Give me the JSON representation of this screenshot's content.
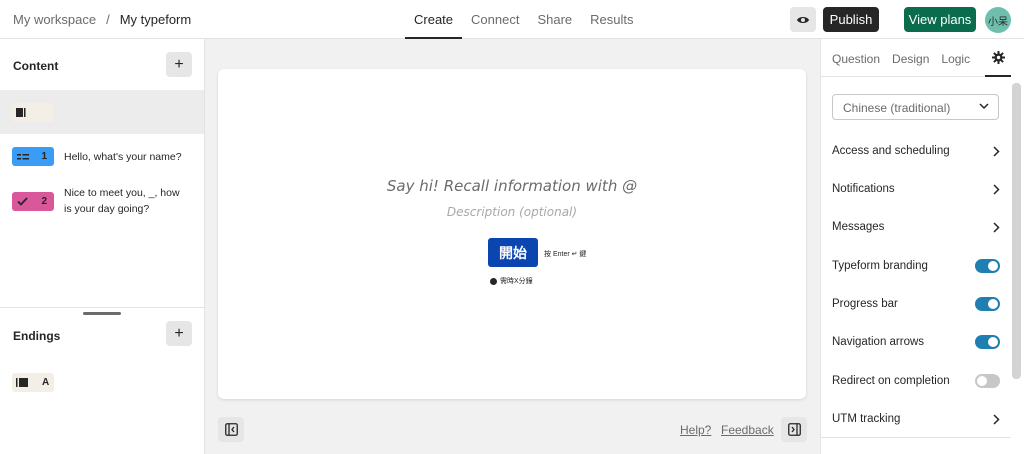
{
  "header": {
    "workspace": "My workspace",
    "separator": "/",
    "form_name": "My typeform",
    "tabs": [
      {
        "label": "Create",
        "active": true
      },
      {
        "label": "Connect",
        "active": false
      },
      {
        "label": "Share",
        "active": false
      },
      {
        "label": "Results",
        "active": false
      }
    ],
    "preview_icon": "eye-icon",
    "publish_label": "Publish",
    "plans_label": "View plans",
    "avatar_text": "小呆",
    "colors": {
      "publish": "#262627",
      "plans": "#0b6b4d",
      "avatar": "#6fbfae"
    }
  },
  "left": {
    "content_title": "Content",
    "add_symbol": "+",
    "questions": [
      {
        "number": "1",
        "text": "Hello, what's your name?",
        "icon": "short-text-icon",
        "color": "#3b9cf5"
      },
      {
        "number": "2",
        "text": "Nice to meet you, _, how is your day going?",
        "icon": "checkmark-icon",
        "color": "#d9579b"
      }
    ],
    "endings_title": "Endings",
    "ending_letter": "A"
  },
  "canvas": {
    "title": "Say hi! Recall information with @",
    "description": "Description (optional)",
    "start_label": "開始",
    "enter_hint": "按 Enter ↵ 鍵",
    "time_hint": "需時X分鐘",
    "help_label": "Help?",
    "feedback_label": "Feedback",
    "start_color": "#0a45b0"
  },
  "right": {
    "tabs": [
      {
        "label": "Question",
        "active": false
      },
      {
        "label": "Design",
        "active": false
      },
      {
        "label": "Logic",
        "active": false
      }
    ],
    "settings_icon": "gear-icon",
    "language": "Chinese (traditional)",
    "settings": [
      {
        "label": "Access and scheduling",
        "type": "link"
      },
      {
        "label": "Notifications",
        "type": "link"
      },
      {
        "label": "Messages",
        "type": "link"
      },
      {
        "label": "Typeform branding",
        "type": "toggle",
        "on": true
      },
      {
        "label": "Progress bar",
        "type": "toggle",
        "on": true
      },
      {
        "label": "Navigation arrows",
        "type": "toggle",
        "on": true
      },
      {
        "label": "Redirect on completion",
        "type": "toggle",
        "on": false
      },
      {
        "label": "UTM tracking",
        "type": "link"
      }
    ],
    "toggle_on_color": "#1f7fb0"
  }
}
